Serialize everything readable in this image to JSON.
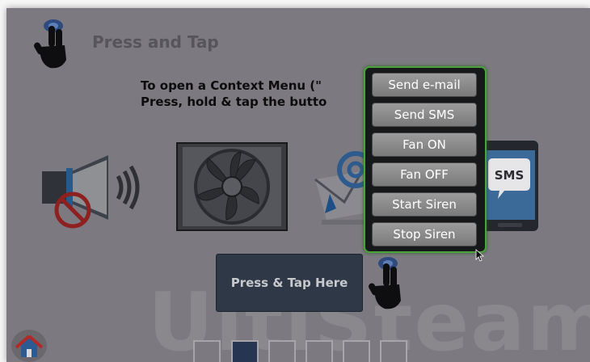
{
  "header": {
    "title": "Press and Tap"
  },
  "instructions": {
    "line1": "To open a Context Menu (\"",
    "line2": "Press, hold & tap the butto"
  },
  "watermark": "UltiSteam",
  "press_button": {
    "label": "Press & Tap Here"
  },
  "context_menu": {
    "items": [
      {
        "label": "Send e-mail"
      },
      {
        "label": "Send SMS"
      },
      {
        "label": "Fan ON"
      },
      {
        "label": "Fan OFF"
      },
      {
        "label": "Start Siren"
      },
      {
        "label": "Stop Siren"
      }
    ]
  },
  "devices": {
    "phone_label": "SMS"
  },
  "pagination": {
    "count": 6,
    "active_index": 1
  },
  "colors": {
    "overlay": "#7c7a80",
    "menu_border": "#4ca33b",
    "press_button": "#2f3846",
    "active_page": "#263552"
  },
  "icons": [
    "touch-hand-icon",
    "siren-speaker-icon",
    "fan-icon",
    "email-icon",
    "phone-sms-icon",
    "home-icon",
    "mouse-cursor-icon"
  ]
}
